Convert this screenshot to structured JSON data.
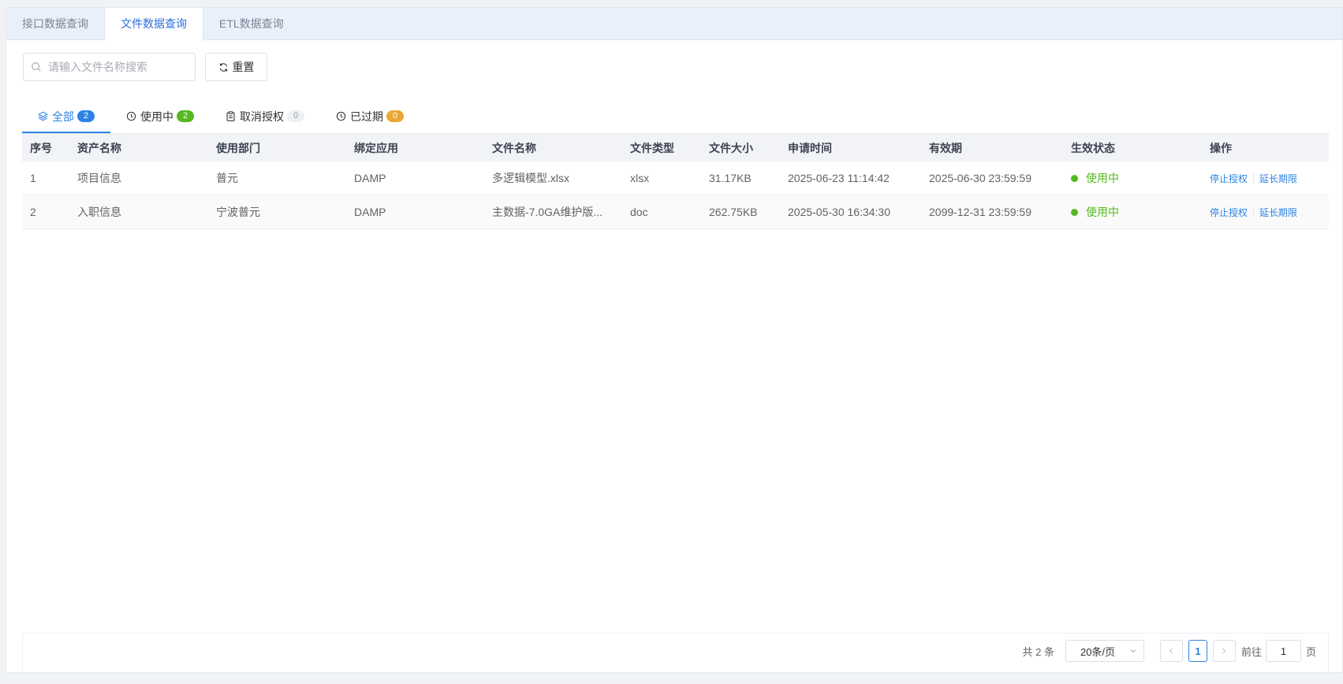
{
  "top_tabs": [
    {
      "label": "接口数据查询",
      "active": false
    },
    {
      "label": "文件数据查询",
      "active": true
    },
    {
      "label": "ETL数据查询",
      "active": false
    }
  ],
  "search": {
    "placeholder": "请输入文件名称搜索",
    "value": ""
  },
  "reset_label": "重置",
  "status_tabs": [
    {
      "label": "全部",
      "count": "2",
      "icon": "layers-icon",
      "badge_color": "#2c83e5",
      "active": true
    },
    {
      "label": "使用中",
      "count": "2",
      "icon": "clock-icon",
      "badge_color": "#54b81e",
      "active": false
    },
    {
      "label": "取消授权",
      "count": "0",
      "icon": "clipboard-icon",
      "badge_color": "#eef0f3",
      "active": false
    },
    {
      "label": "已过期",
      "count": "0",
      "icon": "clock-icon",
      "badge_color": "#eba733",
      "active": false
    }
  ],
  "table": {
    "headers": [
      "序号",
      "资产名称",
      "使用部门",
      "绑定应用",
      "文件名称",
      "文件类型",
      "文件大小",
      "申请时间",
      "有效期",
      "生效状态",
      "操作"
    ],
    "rows": [
      {
        "index": "1",
        "asset": "项目信息",
        "dept": "普元",
        "app": "DAMP",
        "file": "多逻辑模型.xlsx",
        "type": "xlsx",
        "size": "31.17KB",
        "applied": "2025-06-23 11:14:42",
        "valid_until": "2025-06-30 23:59:59",
        "status": "使用中",
        "actions": [
          "停止授权",
          "延长期限"
        ]
      },
      {
        "index": "2",
        "asset": "入职信息",
        "dept": "宁波普元",
        "app": "DAMP",
        "file": "主数据-7.0GA维护版...",
        "type": "doc",
        "size": "262.75KB",
        "applied": "2025-05-30 16:34:30",
        "valid_until": "2099-12-31 23:59:59",
        "status": "使用中",
        "actions": [
          "停止授权",
          "延长期限"
        ]
      }
    ]
  },
  "pagination": {
    "total": "共 2 条",
    "page_size": "20条/页",
    "current_page": "1",
    "goto_label": "前往",
    "goto_value": "1",
    "page_suffix": "页"
  },
  "colors": {
    "accent": "#2c83e5",
    "active_status": "#54b81e"
  }
}
